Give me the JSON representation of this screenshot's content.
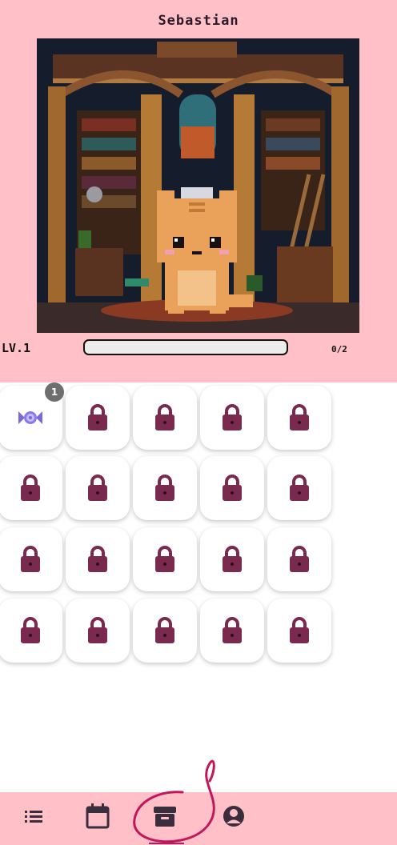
{
  "pet": {
    "name": "Sebastian",
    "level": "LV.1",
    "xp_text": "0/2",
    "xp_fraction": 0
  },
  "items": [
    {
      "type": "candy",
      "icon": "candy-icon",
      "count": "1",
      "locked": false
    },
    {
      "type": "locked",
      "icon": "lock-icon",
      "locked": true
    },
    {
      "type": "locked",
      "icon": "lock-icon",
      "locked": true
    },
    {
      "type": "locked",
      "icon": "lock-icon",
      "locked": true
    },
    {
      "type": "locked",
      "icon": "lock-icon",
      "locked": true
    },
    {
      "type": "locked",
      "icon": "lock-icon",
      "locked": true
    },
    {
      "type": "locked",
      "icon": "lock-icon",
      "locked": true
    },
    {
      "type": "locked",
      "icon": "lock-icon",
      "locked": true
    },
    {
      "type": "locked",
      "icon": "lock-icon",
      "locked": true
    },
    {
      "type": "locked",
      "icon": "lock-icon",
      "locked": true
    },
    {
      "type": "locked",
      "icon": "lock-icon",
      "locked": true
    },
    {
      "type": "locked",
      "icon": "lock-icon",
      "locked": true
    },
    {
      "type": "locked",
      "icon": "lock-icon",
      "locked": true
    },
    {
      "type": "locked",
      "icon": "lock-icon",
      "locked": true
    },
    {
      "type": "locked",
      "icon": "lock-icon",
      "locked": true
    },
    {
      "type": "locked",
      "icon": "lock-icon",
      "locked": true
    },
    {
      "type": "locked",
      "icon": "lock-icon",
      "locked": true
    },
    {
      "type": "locked",
      "icon": "lock-icon",
      "locked": true
    },
    {
      "type": "locked",
      "icon": "lock-icon",
      "locked": true
    },
    {
      "type": "locked",
      "icon": "lock-icon",
      "locked": true
    }
  ],
  "nav": [
    {
      "icon": "list-icon",
      "active": false
    },
    {
      "icon": "calendar-icon",
      "active": false
    },
    {
      "icon": "archive-box-icon",
      "active": true
    },
    {
      "icon": "user-circle-icon",
      "active": false
    }
  ],
  "colors": {
    "header_bg": "#ffc0c8",
    "lock": "#7a2a4e",
    "nav_icon": "#3a2d3d",
    "annotation": "#c2185b"
  }
}
